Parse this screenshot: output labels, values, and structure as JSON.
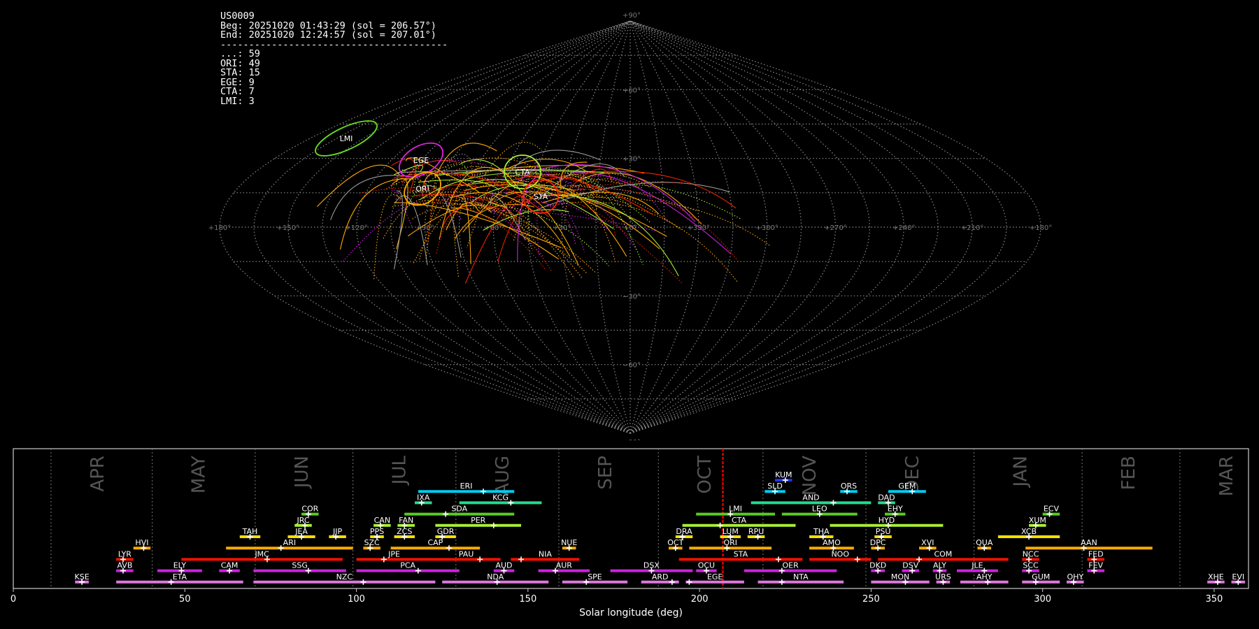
{
  "header": {
    "station": "US0009",
    "begin": "Beg: 20251020 01:43:29 (sol = 206.57°)",
    "end": "End: 20251020 12:24:57 (sol = 207.01°)",
    "separator": "----------------------------------------",
    "counts": [
      {
        "code": "...",
        "count": 59
      },
      {
        "code": "ORI",
        "count": 49
      },
      {
        "code": "STA",
        "count": 15
      },
      {
        "code": "EGE",
        "count": 9
      },
      {
        "code": "CTA",
        "count": 7
      },
      {
        "code": "LMI",
        "count": 3
      }
    ]
  },
  "sky_map": {
    "lon_labels": [
      "+180°",
      "+150°",
      "+120°",
      "+90°",
      "+60°",
      "+30°",
      "+0°",
      "+330°",
      "+300°",
      "+270°",
      "+240°",
      "+210°",
      "+180°"
    ],
    "lat_labels": [
      "+90°",
      "+60°",
      "+30°",
      "−30°",
      "−60°",
      "−90°"
    ],
    "shower_circles": [
      {
        "code": "LMI",
        "color": "#66dd22"
      },
      {
        "code": "EGE",
        "color": "#dd22dd"
      },
      {
        "code": "ORI",
        "color": "#ffaa00"
      },
      {
        "code": "CTA",
        "color": "#aaee33"
      },
      {
        "code": "STA",
        "color": "#ff2200"
      }
    ]
  },
  "chart_data": {
    "type": "timeline",
    "xlabel": "Solar longitude (deg)",
    "xlim": [
      0,
      360
    ],
    "xticks": [
      0,
      50,
      100,
      150,
      200,
      250,
      300,
      350
    ],
    "current_sol": 206.8,
    "months": [
      {
        "name": "APR",
        "start": 11
      },
      {
        "name": "MAY",
        "start": 40.5
      },
      {
        "name": "JUN",
        "start": 70.5
      },
      {
        "name": "JUL",
        "start": 99
      },
      {
        "name": "AUG",
        "start": 129
      },
      {
        "name": "SEP",
        "start": 159
      },
      {
        "name": "OCT",
        "start": 188
      },
      {
        "name": "NOV",
        "start": 218.5
      },
      {
        "name": "DEC",
        "start": 248.5
      },
      {
        "name": "JAN",
        "start": 280
      },
      {
        "name": "FEB",
        "start": 311.5
      },
      {
        "name": "MAR",
        "start": 340
      }
    ],
    "showers": [
      {
        "code": "KUM",
        "start": 222,
        "end": 227,
        "peak": 225,
        "row": 0,
        "color": "#2233ee"
      },
      {
        "code": "ERI",
        "start": 118,
        "end": 146,
        "peak": 137,
        "row": 1,
        "color": "#00ccee"
      },
      {
        "code": "SLD",
        "start": 219,
        "end": 225,
        "peak": 222,
        "row": 1,
        "color": "#00ccee"
      },
      {
        "code": "ORS",
        "start": 241,
        "end": 246,
        "peak": 243,
        "row": 1,
        "color": "#00ccee"
      },
      {
        "code": "GEM",
        "start": 255,
        "end": 266,
        "peak": 262,
        "row": 1,
        "color": "#00ccee"
      },
      {
        "code": "IXA",
        "start": 117,
        "end": 122,
        "peak": 119,
        "row": 2,
        "color": "#22dd88"
      },
      {
        "code": "KCG",
        "start": 130,
        "end": 154,
        "peak": 145,
        "row": 2,
        "color": "#22dd88"
      },
      {
        "code": "AND",
        "start": 215,
        "end": 250,
        "peak": 239,
        "row": 2,
        "color": "#22dd88"
      },
      {
        "code": "DAD",
        "start": 252,
        "end": 257,
        "peak": 255,
        "row": 2,
        "color": "#22dd88"
      },
      {
        "code": "COR",
        "start": 84,
        "end": 89,
        "peak": 86,
        "row": 3,
        "color": "#55cc22"
      },
      {
        "code": "SDA",
        "start": 114,
        "end": 146,
        "peak": 126,
        "row": 3,
        "color": "#55cc22"
      },
      {
        "code": "LMI",
        "start": 199,
        "end": 222,
        "peak": 209,
        "row": 3,
        "color": "#55cc22"
      },
      {
        "code": "LEO",
        "start": 224,
        "end": 246,
        "peak": 235,
        "row": 3,
        "color": "#55cc22"
      },
      {
        "code": "EHY",
        "start": 254,
        "end": 260,
        "peak": 257,
        "row": 3,
        "color": "#55cc22"
      },
      {
        "code": "ECV",
        "start": 300,
        "end": 305,
        "peak": 302,
        "row": 3,
        "color": "#55cc22"
      },
      {
        "code": "JRC",
        "start": 82,
        "end": 87,
        "peak": 85,
        "row": 4,
        "color": "#aaee33"
      },
      {
        "code": "CAN",
        "start": 105,
        "end": 110,
        "peak": 107,
        "row": 4,
        "color": "#aaee33"
      },
      {
        "code": "FAN",
        "start": 112,
        "end": 117,
        "peak": 114,
        "row": 4,
        "color": "#aaee33"
      },
      {
        "code": "PER",
        "start": 123,
        "end": 148,
        "peak": 140,
        "row": 4,
        "color": "#aaee33"
      },
      {
        "code": "CTA",
        "start": 195,
        "end": 228,
        "peak": 206,
        "row": 4,
        "color": "#aaee33"
      },
      {
        "code": "HYD",
        "start": 238,
        "end": 271,
        "peak": 255,
        "row": 4,
        "color": "#aaee33"
      },
      {
        "code": "XUM",
        "start": 296,
        "end": 301,
        "peak": 298,
        "row": 4,
        "color": "#aaee33"
      },
      {
        "code": "TAH",
        "start": 66,
        "end": 72,
        "peak": 69,
        "row": 5,
        "color": "#ffdd00"
      },
      {
        "code": "JEA",
        "start": 80,
        "end": 88,
        "peak": 84,
        "row": 5,
        "color": "#ffdd00"
      },
      {
        "code": "JIP",
        "start": 92,
        "end": 97,
        "peak": 94,
        "row": 5,
        "color": "#ffdd00"
      },
      {
        "code": "PPS",
        "start": 104,
        "end": 108,
        "peak": 106,
        "row": 5,
        "color": "#ffdd00"
      },
      {
        "code": "ZCS",
        "start": 111,
        "end": 117,
        "peak": 114,
        "row": 5,
        "color": "#ffdd00"
      },
      {
        "code": "GDR",
        "start": 123,
        "end": 129,
        "peak": 125,
        "row": 5,
        "color": "#ffdd00"
      },
      {
        "code": "DRA",
        "start": 193,
        "end": 198,
        "peak": 195,
        "row": 5,
        "color": "#ffdd00"
      },
      {
        "code": "LUM",
        "start": 206,
        "end": 212,
        "peak": 209,
        "row": 5,
        "color": "#ffdd00"
      },
      {
        "code": "RPU",
        "start": 214,
        "end": 219,
        "peak": 217,
        "row": 5,
        "color": "#ffdd00"
      },
      {
        "code": "THA",
        "start": 232,
        "end": 239,
        "peak": 236,
        "row": 5,
        "color": "#ffdd00"
      },
      {
        "code": "PSU",
        "start": 251,
        "end": 256,
        "peak": 253,
        "row": 5,
        "color": "#ffdd00"
      },
      {
        "code": "XCB",
        "start": 287,
        "end": 305,
        "peak": 296,
        "row": 5,
        "color": "#ffdd00"
      },
      {
        "code": "HVI",
        "start": 35,
        "end": 40,
        "peak": 38,
        "row": 6,
        "color": "#ffaa00"
      },
      {
        "code": "ARI",
        "start": 62,
        "end": 99,
        "peak": 78,
        "row": 6,
        "color": "#ffaa00"
      },
      {
        "code": "SZC",
        "start": 102,
        "end": 107,
        "peak": 104,
        "row": 6,
        "color": "#ffaa00"
      },
      {
        "code": "CAP",
        "start": 110,
        "end": 136,
        "peak": 127,
        "row": 6,
        "color": "#ffaa00"
      },
      {
        "code": "NUE",
        "start": 160,
        "end": 164,
        "peak": 162,
        "row": 6,
        "color": "#ffaa00"
      },
      {
        "code": "OCT",
        "start": 191,
        "end": 195,
        "peak": 193,
        "row": 6,
        "color": "#ffaa00"
      },
      {
        "code": "ORI",
        "start": 197,
        "end": 221,
        "peak": 208,
        "row": 6,
        "color": "#ffaa00"
      },
      {
        "code": "AMO",
        "start": 232,
        "end": 245,
        "peak": 239,
        "row": 6,
        "color": "#ffaa00"
      },
      {
        "code": "DPC",
        "start": 250,
        "end": 254,
        "peak": 252,
        "row": 6,
        "color": "#ffaa00"
      },
      {
        "code": "XVI",
        "start": 264,
        "end": 269,
        "peak": 267,
        "row": 6,
        "color": "#ffaa00"
      },
      {
        "code": "QUA",
        "start": 281,
        "end": 285,
        "peak": 283,
        "row": 6,
        "color": "#ffaa00"
      },
      {
        "code": "AAN",
        "start": 295,
        "end": 332,
        "peak": 312,
        "row": 6,
        "color": "#ffaa00"
      },
      {
        "code": "LYR",
        "start": 30,
        "end": 35,
        "peak": 32,
        "row": 7,
        "color": "#ee1100"
      },
      {
        "code": "JMC",
        "start": 49,
        "end": 96,
        "peak": 74,
        "row": 7,
        "color": "#ee1100"
      },
      {
        "code": "JPE",
        "start": 100,
        "end": 122,
        "peak": 108,
        "row": 7,
        "color": "#ee1100"
      },
      {
        "code": "PAU",
        "start": 122,
        "end": 142,
        "peak": 136,
        "row": 7,
        "color": "#ee1100"
      },
      {
        "code": "NIA",
        "start": 145,
        "end": 165,
        "peak": 148,
        "row": 7,
        "color": "#ee1100"
      },
      {
        "code": "STA",
        "start": 194,
        "end": 230,
        "peak": 223,
        "row": 7,
        "color": "#ee1100"
      },
      {
        "code": "NOO",
        "start": 232,
        "end": 250,
        "peak": 246,
        "row": 7,
        "color": "#ee1100"
      },
      {
        "code": "COM",
        "start": 252,
        "end": 290,
        "peak": 264,
        "row": 7,
        "color": "#ee1100"
      },
      {
        "code": "NCC",
        "start": 294,
        "end": 299,
        "peak": 296,
        "row": 7,
        "color": "#ee1100"
      },
      {
        "code": "FED",
        "start": 313,
        "end": 318,
        "peak": 315,
        "row": 7,
        "color": "#ee1100"
      },
      {
        "code": "AVB",
        "start": 30,
        "end": 35,
        "peak": 32,
        "row": 8,
        "color": "#cc22dd"
      },
      {
        "code": "ELY",
        "start": 42,
        "end": 55,
        "peak": 49,
        "row": 8,
        "color": "#cc22dd"
      },
      {
        "code": "CAM",
        "start": 60,
        "end": 66,
        "peak": 63,
        "row": 8,
        "color": "#cc22dd"
      },
      {
        "code": "SSG",
        "start": 70,
        "end": 97,
        "peak": 86,
        "row": 8,
        "color": "#cc22dd"
      },
      {
        "code": "PCA",
        "start": 100,
        "end": 130,
        "peak": 118,
        "row": 8,
        "color": "#cc22dd"
      },
      {
        "code": "AUD",
        "start": 140,
        "end": 146,
        "peak": 143,
        "row": 8,
        "color": "#cc22dd"
      },
      {
        "code": "AUR",
        "start": 153,
        "end": 168,
        "peak": 158,
        "row": 8,
        "color": "#cc22dd"
      },
      {
        "code": "DSX",
        "start": 174,
        "end": 198,
        "peak": 186,
        "row": 8,
        "color": "#cc22dd"
      },
      {
        "code": "OCU",
        "start": 199,
        "end": 205,
        "peak": 202,
        "row": 8,
        "color": "#cc22dd"
      },
      {
        "code": "OER",
        "start": 213,
        "end": 240,
        "peak": 224,
        "row": 8,
        "color": "#cc22dd"
      },
      {
        "code": "DKD",
        "start": 250,
        "end": 254,
        "peak": 252,
        "row": 8,
        "color": "#cc22dd"
      },
      {
        "code": "DSV",
        "start": 259,
        "end": 264,
        "peak": 262,
        "row": 8,
        "color": "#cc22dd"
      },
      {
        "code": "ALY",
        "start": 268,
        "end": 272,
        "peak": 270,
        "row": 8,
        "color": "#cc22dd"
      },
      {
        "code": "JLE",
        "start": 275,
        "end": 287,
        "peak": 283,
        "row": 8,
        "color": "#cc22dd"
      },
      {
        "code": "SCC",
        "start": 294,
        "end": 299,
        "peak": 296,
        "row": 8,
        "color": "#cc22dd"
      },
      {
        "code": "FEV",
        "start": 313,
        "end": 318,
        "peak": 315,
        "row": 8,
        "color": "#cc22dd"
      },
      {
        "code": "KSE",
        "start": 18,
        "end": 22,
        "peak": 20,
        "row": 9,
        "color": "#dd77dd"
      },
      {
        "code": "ETA",
        "start": 30,
        "end": 67,
        "peak": 46,
        "row": 9,
        "color": "#dd77dd"
      },
      {
        "code": "NZC",
        "start": 70,
        "end": 123,
        "peak": 102,
        "row": 9,
        "color": "#dd77dd"
      },
      {
        "code": "NDA",
        "start": 125,
        "end": 156,
        "peak": 141,
        "row": 9,
        "color": "#dd77dd"
      },
      {
        "code": "SPE",
        "start": 160,
        "end": 179,
        "peak": 167,
        "row": 9,
        "color": "#dd77dd"
      },
      {
        "code": "ARD",
        "start": 183,
        "end": 194,
        "peak": 192,
        "row": 9,
        "color": "#dd77dd"
      },
      {
        "code": "EGE",
        "start": 196,
        "end": 213,
        "peak": 197,
        "row": 9,
        "color": "#dd77dd"
      },
      {
        "code": "NTA",
        "start": 217,
        "end": 242,
        "peak": 224,
        "row": 9,
        "color": "#dd77dd"
      },
      {
        "code": "MON",
        "start": 250,
        "end": 267,
        "peak": 260,
        "row": 9,
        "color": "#dd77dd"
      },
      {
        "code": "URS",
        "start": 269,
        "end": 273,
        "peak": 271,
        "row": 9,
        "color": "#dd77dd"
      },
      {
        "code": "AHY",
        "start": 276,
        "end": 290,
        "peak": 284,
        "row": 9,
        "color": "#dd77dd"
      },
      {
        "code": "GUM",
        "start": 294,
        "end": 305,
        "peak": 298,
        "row": 9,
        "color": "#dd77dd"
      },
      {
        "code": "OHY",
        "start": 307,
        "end": 312,
        "peak": 309,
        "row": 9,
        "color": "#dd77dd"
      },
      {
        "code": "XHE",
        "start": 348,
        "end": 353,
        "peak": 351,
        "row": 9,
        "color": "#dd77dd"
      },
      {
        "code": "EVI",
        "start": 355,
        "end": 359,
        "peak": 357,
        "row": 9,
        "color": "#dd77dd"
      }
    ]
  }
}
